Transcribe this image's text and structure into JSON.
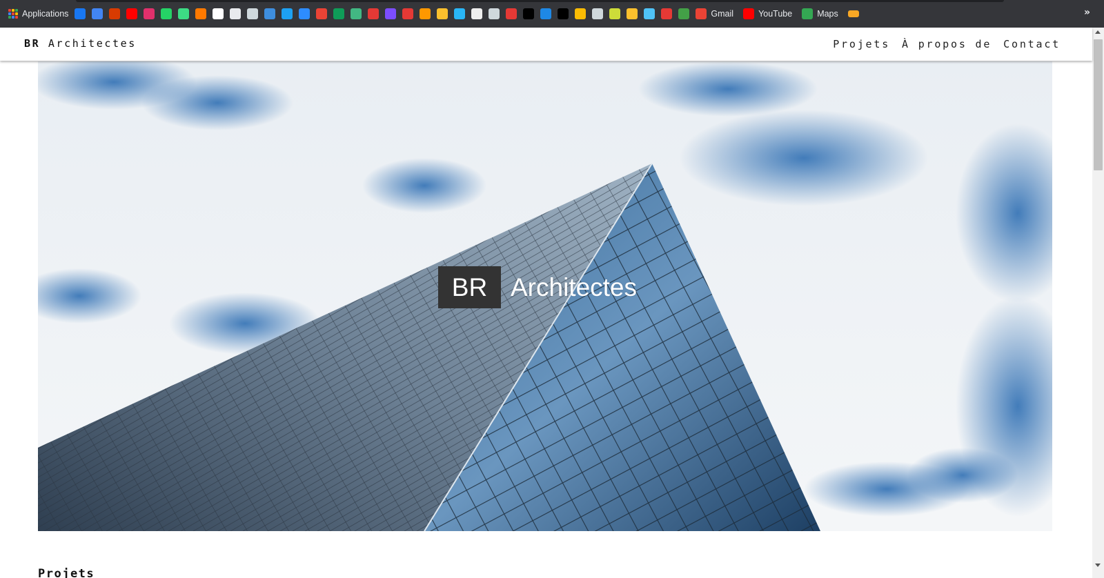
{
  "bookmarks": {
    "apps_label": "Applications",
    "items": [
      {
        "icon": "facebook-icon",
        "color": "#1877f2"
      },
      {
        "icon": "google-translate-icon",
        "color": "#4285f4"
      },
      {
        "icon": "office-icon",
        "color": "#d83b01"
      },
      {
        "icon": "youtube-icon",
        "color": "#ff0000"
      },
      {
        "icon": "instagram-icon",
        "color": "#e1306c"
      },
      {
        "icon": "whatsapp-icon",
        "color": "#25d366"
      },
      {
        "icon": "android-icon",
        "color": "#3ddc84"
      },
      {
        "icon": "orange-icon",
        "color": "#ff7900"
      },
      {
        "icon": "amazon-icon",
        "color": "#ffffff"
      },
      {
        "icon": "globe-icon",
        "color": "#e8eaed"
      },
      {
        "icon": "document-icon",
        "color": "#cfd8dc"
      },
      {
        "icon": "bird-icon",
        "color": "#3e8ede"
      },
      {
        "icon": "twitter-icon",
        "color": "#1da1f2"
      },
      {
        "icon": "video-icon",
        "color": "#2d8cff"
      },
      {
        "icon": "gmail-icon",
        "color": "#ea4335"
      },
      {
        "icon": "x-icon",
        "color": "#0f9d58"
      },
      {
        "icon": "vue-icon",
        "color": "#42b883"
      },
      {
        "icon": "ef-icon",
        "color": "#e53935"
      },
      {
        "icon": "d-icon",
        "color": "#7c4dff"
      },
      {
        "icon": "target-icon",
        "color": "#e53935"
      },
      {
        "icon": "diamond-icon",
        "color": "#ff9800"
      },
      {
        "icon": "booking-icon",
        "color": "#fbc02d"
      },
      {
        "icon": "screen-icon",
        "color": "#29b6f6"
      },
      {
        "icon": "clock-icon",
        "color": "#eeeeee"
      },
      {
        "icon": "document-icon",
        "color": "#cfd8dc"
      },
      {
        "icon": "heart-icon",
        "color": "#e53935"
      },
      {
        "icon": "c-icon",
        "color": "#000000"
      },
      {
        "icon": "d-square-icon",
        "color": "#1e88e5"
      },
      {
        "icon": "plus-icon",
        "color": "#000000"
      },
      {
        "icon": "drive-icon",
        "color": "#fbbc04"
      },
      {
        "icon": "document-icon",
        "color": "#cfd8dc"
      },
      {
        "icon": "layers-icon",
        "color": "#cddc39"
      },
      {
        "icon": "oval-icon",
        "color": "#fbc02d"
      },
      {
        "icon": "download-icon",
        "color": "#4fc3f7"
      },
      {
        "icon": "huawei-icon",
        "color": "#e53935"
      },
      {
        "icon": "stripes-icon",
        "color": "#43a047"
      }
    ],
    "labeled": [
      {
        "icon": "gmail-icon",
        "label": "Gmail",
        "color": "#ea4335"
      },
      {
        "icon": "youtube-icon",
        "label": "YouTube",
        "color": "#ff0000"
      },
      {
        "icon": "maps-icon",
        "label": "Maps",
        "color": "#34a853"
      }
    ],
    "more": "»"
  },
  "header": {
    "brand_bold": "BR",
    "brand_rest": "Architectes",
    "nav": [
      "Projets",
      "À propos de",
      "Contact"
    ]
  },
  "hero": {
    "title_box": "BR",
    "title_rest": "Architectes"
  },
  "sections": {
    "projects_heading": "Projets"
  }
}
